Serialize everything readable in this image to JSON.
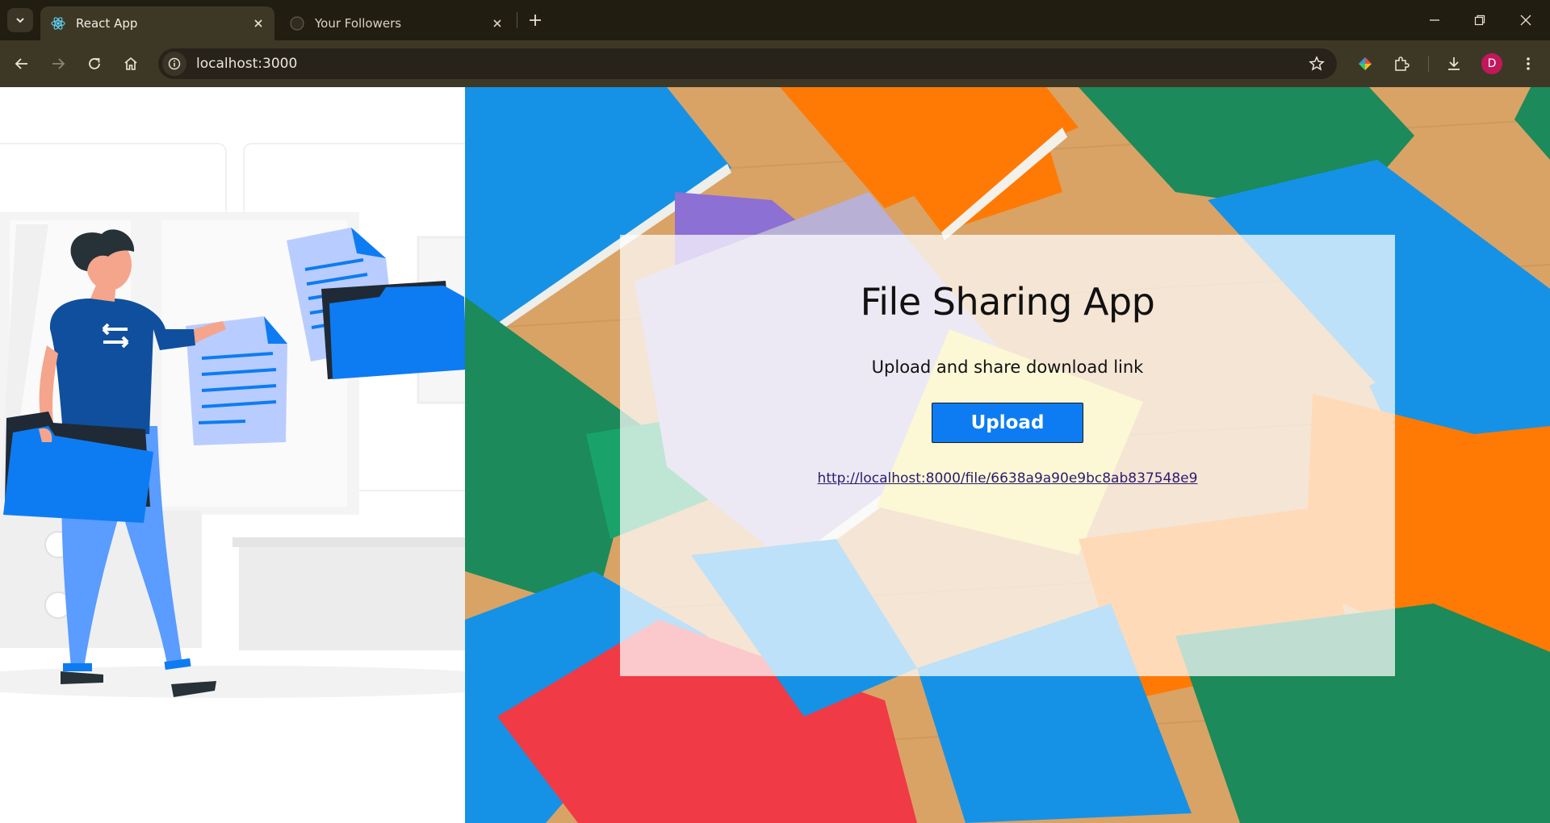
{
  "browser": {
    "tabs": [
      {
        "title": "React App",
        "active": true,
        "icon": "react-icon"
      },
      {
        "title": "Your Followers",
        "active": false,
        "icon": "github-icon"
      }
    ],
    "address": "localhost:3000",
    "profile_initial": "D",
    "colors": {
      "frame": "#211d11",
      "toolbar": "#3d3826",
      "avatar": "#c2185b"
    }
  },
  "app": {
    "title": "File Sharing App",
    "subtitle": "Upload and share download link",
    "upload_label": "Upload",
    "download_link": "http://localhost:8000/file/6638a9a90e9bc8ab837548e9",
    "colors": {
      "button": "#0d7cf2",
      "link": "#2b1b6e"
    }
  }
}
